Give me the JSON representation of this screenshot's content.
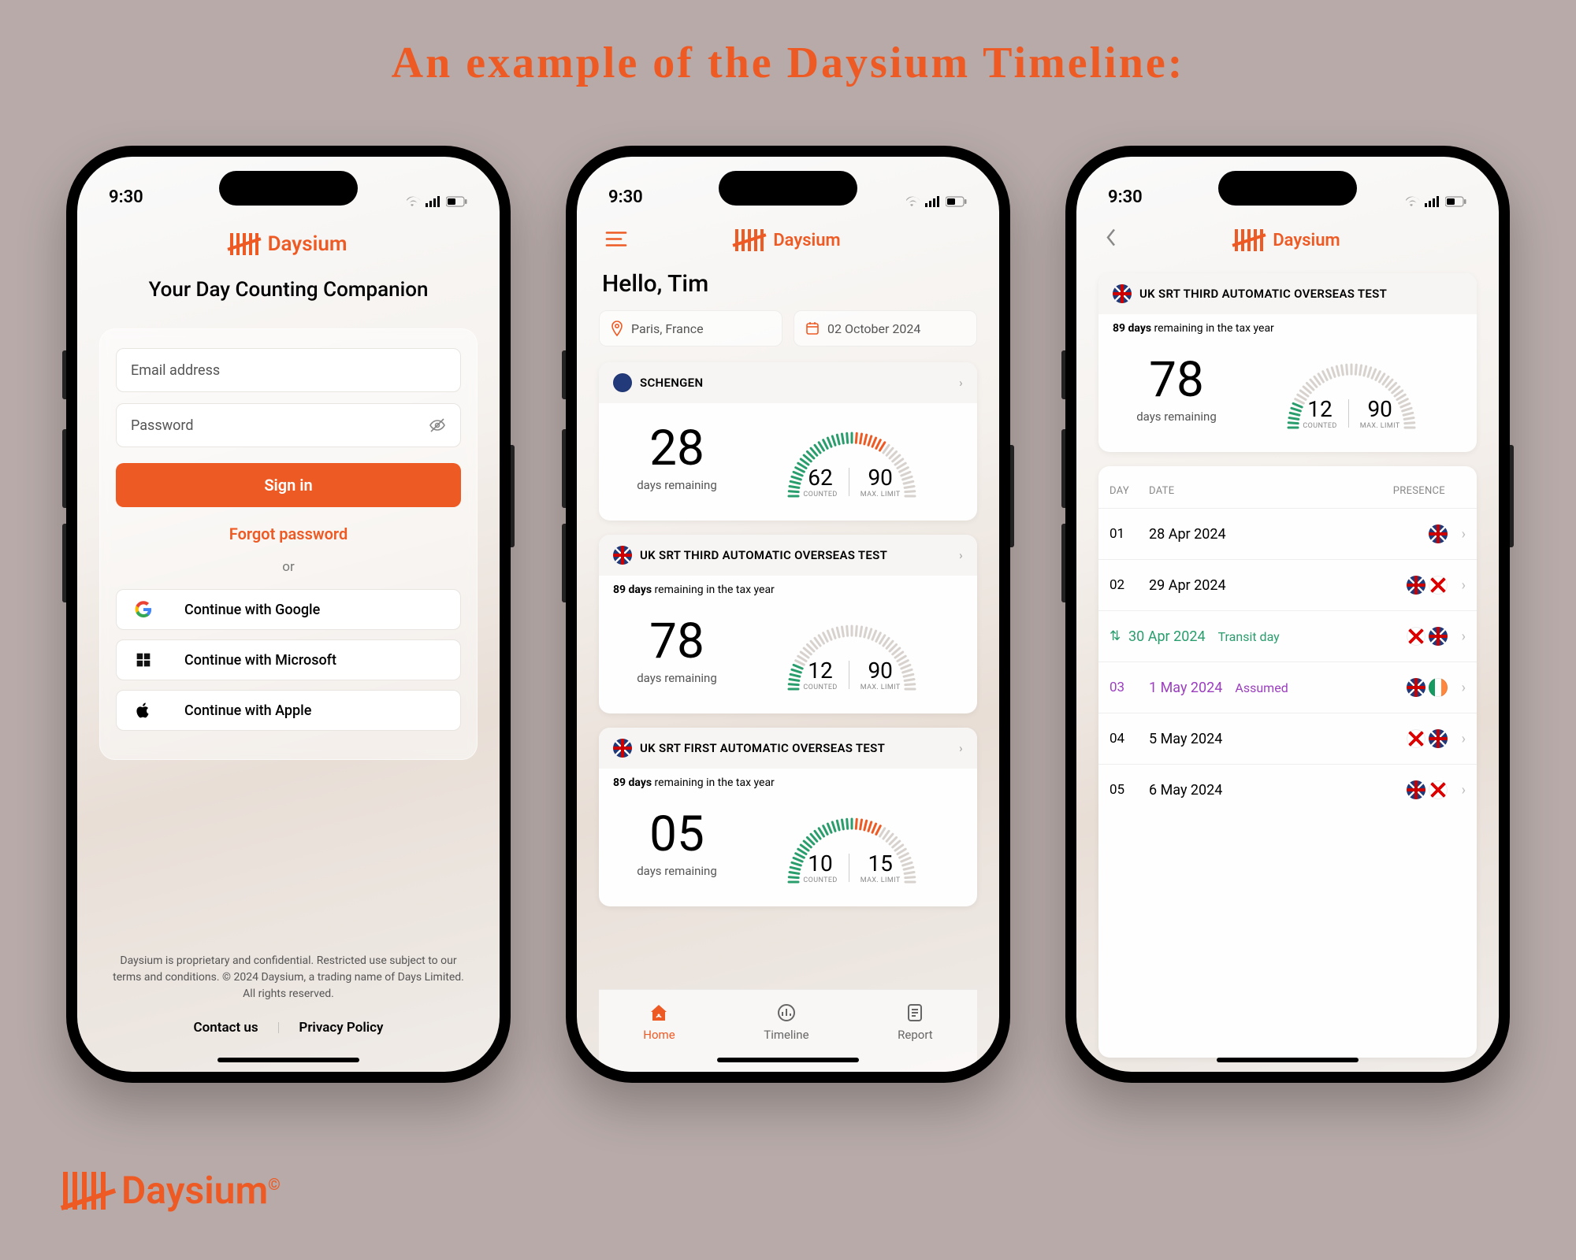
{
  "page": {
    "title": "An example of the Daysium Timeline:"
  },
  "brand": {
    "name": "Daysium"
  },
  "status": {
    "time": "9:30"
  },
  "signin": {
    "tagline": "Your Day Counting Companion",
    "email_ph": "Email address",
    "password_ph": "Password",
    "submit": "Sign in",
    "forgot": "Forgot password",
    "or": "or",
    "google": "Continue with Google",
    "microsoft": "Continue with Microsoft",
    "apple": "Continue with Apple",
    "legal": "Daysium is proprietary and confidential. Restricted use subject to our terms and conditions. © 2024 Daysium, a trading name of Days Limited. All rights reserved.",
    "contact": "Contact us",
    "privacy": "Privacy Policy"
  },
  "dashboard": {
    "greeting": "Hello, Tim",
    "location": "Paris, France",
    "date": "02 October 2024",
    "cards": [
      {
        "title": "SCHENGEN",
        "flag": "eu",
        "subhead_days": "",
        "days_remaining": "28",
        "counted": "62",
        "max": "90"
      },
      {
        "title": "UK SRT THIRD AUTOMATIC OVERSEAS TEST",
        "flag": "uk",
        "subhead_days": "89 days",
        "subhead_rest": " remaining in the tax year",
        "days_remaining": "78",
        "counted": "12",
        "max": "90"
      },
      {
        "title": "UK SRT FIRST AUTOMATIC OVERSEAS TEST",
        "flag": "uk",
        "subhead_days": "89 days",
        "subhead_rest": " remaining in the tax year",
        "days_remaining": "05",
        "counted": "10",
        "max": "15"
      }
    ],
    "labels": {
      "days_rem": "days remaining",
      "counted": "COUNTED",
      "max": "MAX. LIMIT"
    },
    "tabs": {
      "home": "Home",
      "timeline": "Timeline",
      "report": "Report"
    }
  },
  "timeline": {
    "header": {
      "title": "UK SRT THIRD AUTOMATIC OVERSEAS TEST",
      "flag": "uk",
      "subhead_days": "89 days",
      "subhead_rest": " remaining in the tax year"
    },
    "summary": {
      "days_remaining": "78",
      "counted": "12",
      "max": "90"
    },
    "cols": {
      "day": "DAY",
      "date": "DATE",
      "presence": "PRESENCE"
    },
    "rows": [
      {
        "n": "01",
        "date": "28 Apr 2024",
        "tag": "",
        "type": "",
        "flags": [
          "uk"
        ]
      },
      {
        "n": "02",
        "date": "29 Apr 2024",
        "tag": "",
        "type": "",
        "flags": [
          "uk",
          "je"
        ]
      },
      {
        "n": "",
        "date": "30 Apr 2024",
        "tag": "Transit day",
        "type": "transit",
        "flags": [
          "je",
          "uk"
        ]
      },
      {
        "n": "03",
        "date": "1 May 2024",
        "tag": "Assumed",
        "type": "assumed",
        "flags": [
          "uk",
          "ie"
        ]
      },
      {
        "n": "04",
        "date": "5 May 2024",
        "tag": "",
        "type": "",
        "flags": [
          "je",
          "uk"
        ]
      },
      {
        "n": "05",
        "date": "6 May 2024",
        "tag": "",
        "type": "",
        "flags": [
          "uk",
          "je"
        ]
      }
    ]
  },
  "chart_data": [
    {
      "type": "gauge",
      "title": "SCHENGEN",
      "value": 62,
      "max": 90,
      "remaining": 28
    },
    {
      "type": "gauge",
      "title": "UK SRT THIRD AUTOMATIC OVERSEAS TEST",
      "value": 12,
      "max": 90,
      "remaining": 78
    },
    {
      "type": "gauge",
      "title": "UK SRT FIRST AUTOMATIC OVERSEAS TEST",
      "value": 10,
      "max": 15,
      "remaining": 5
    }
  ]
}
